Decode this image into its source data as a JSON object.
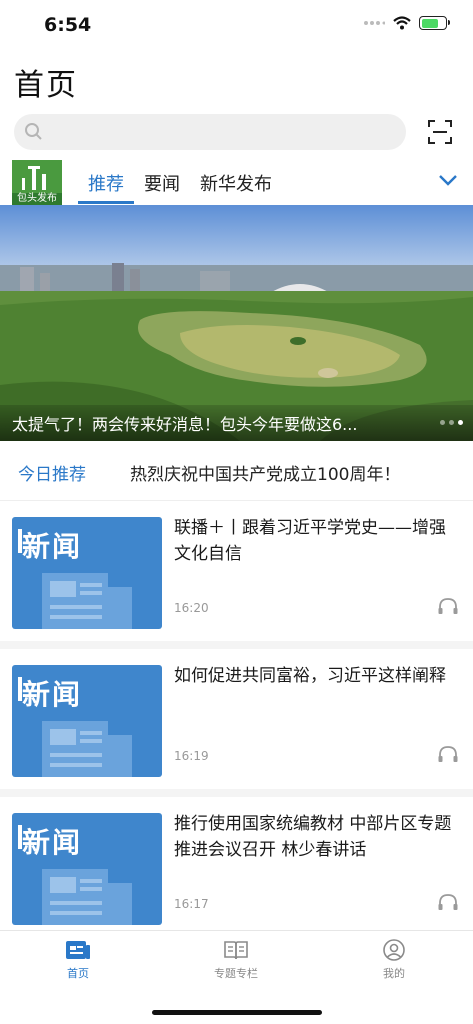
{
  "status_bar": {
    "time": "6:54"
  },
  "header": {
    "title": "首页"
  },
  "search": {
    "placeholder": ""
  },
  "logo": {
    "text": "包头发布"
  },
  "tabs": [
    {
      "label": "推荐",
      "active": true
    },
    {
      "label": "要闻",
      "active": false
    },
    {
      "label": "新华发布",
      "active": false
    }
  ],
  "banner": {
    "caption": "太提气了！两会传来好消息！包头今年要做这6...",
    "slide_count": 3,
    "active_slide": 3
  },
  "today": {
    "label": "今日推荐",
    "text": "热烈庆祝中国共产党成立100周年！"
  },
  "news": [
    {
      "thumb_word": "新闻",
      "title": "联播＋丨跟着习近平学党史——增强文化自信",
      "time": "16:20"
    },
    {
      "thumb_word": "新闻",
      "title": "如何促进共同富裕，习近平这样阐释",
      "time": "16:19"
    },
    {
      "thumb_word": "新闻",
      "title": "推行使用国家统编教材 中部片区专题推进会议召开 林少春讲话",
      "time": "16:17"
    }
  ],
  "tabbar": [
    {
      "label": "首页",
      "icon": "news-icon",
      "active": true
    },
    {
      "label": "专题专栏",
      "icon": "book-icon",
      "active": false
    },
    {
      "label": "我的",
      "icon": "profile-icon",
      "active": false
    }
  ],
  "colors": {
    "accent": "#2a78c8",
    "thumb": "#3f86cc"
  }
}
